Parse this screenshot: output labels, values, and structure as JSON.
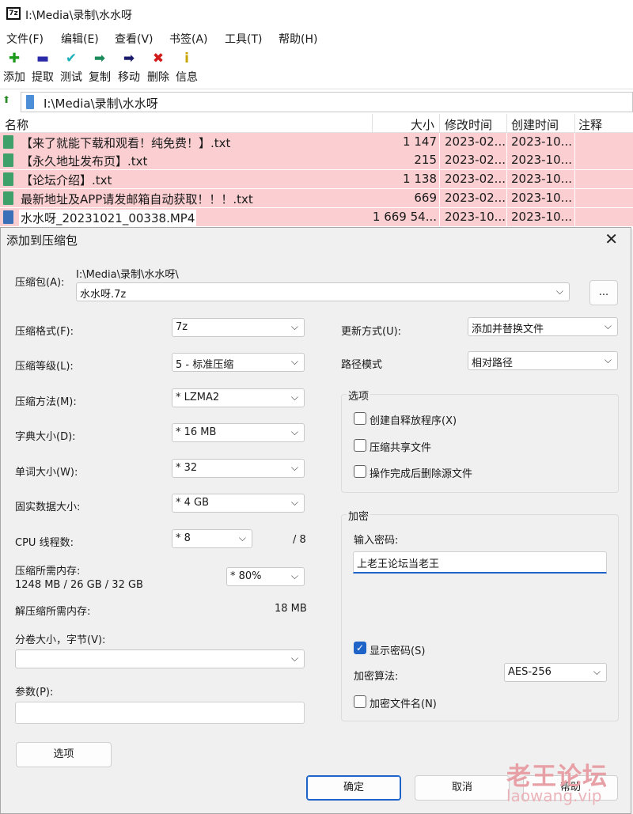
{
  "window": {
    "title": "I:\\Media\\录制\\水水呀",
    "app_icon": "7z"
  },
  "menu": [
    "文件(F)",
    "编辑(E)",
    "查看(V)",
    "书签(A)",
    "工具(T)",
    "帮助(H)"
  ],
  "toolbar": [
    {
      "label": "添加",
      "icon": "plus-icon",
      "glyph": "✚",
      "color": "#1b9a1b"
    },
    {
      "label": "提取",
      "icon": "minus-icon",
      "glyph": "▬",
      "color": "#2a2aa8"
    },
    {
      "label": "测试",
      "icon": "check-icon",
      "glyph": "✔",
      "color": "#1fb0b8"
    },
    {
      "label": "复制",
      "icon": "copy-arrow-icon",
      "glyph": "➡",
      "color": "#1a8a5a"
    },
    {
      "label": "移动",
      "icon": "move-arrow-icon",
      "glyph": "➡",
      "color": "#1a1a6a"
    },
    {
      "label": "删除",
      "icon": "delete-x-icon",
      "glyph": "✖",
      "color": "#d11a1a"
    },
    {
      "label": "信息",
      "icon": "info-icon",
      "glyph": "i",
      "color": "#c8a400"
    }
  ],
  "address": "I:\\Media\\录制\\水水呀",
  "columns": [
    "名称",
    "大小",
    "修改时间",
    "创建时间",
    "注释"
  ],
  "files": [
    {
      "name": "【来了就能下载和观看！纯免费！】.txt",
      "size": "1 147",
      "modified": "2023-02...",
      "created": "2023-10..."
    },
    {
      "name": "【永久地址发布页】.txt",
      "size": "215",
      "modified": "2023-02...",
      "created": "2023-10..."
    },
    {
      "name": "【论坛介绍】.txt",
      "size": "1 138",
      "modified": "2023-02...",
      "created": "2023-10..."
    },
    {
      "name": "最新地址及APP请发邮箱自动获取！！！.txt",
      "size": "669",
      "modified": "2023-02...",
      "created": "2023-10..."
    },
    {
      "name": "水水呀_20231021_00338.MP4",
      "size": "1 669 54...",
      "modified": "2023-10...",
      "created": "2023-10..."
    }
  ],
  "dialog": {
    "title": "添加到压缩包",
    "archive_label": "压缩包(A):",
    "archive_path": "I:\\Media\\录制\\水水呀\\",
    "archive_name": "水水呀.7z",
    "browse": "...",
    "format_label": "压缩格式(F):",
    "format": "7z",
    "level_label": "压缩等级(L):",
    "level": "5 - 标准压缩",
    "method_label": "压缩方法(M):",
    "method": "*  LZMA2",
    "dict_label": "字典大小(D):",
    "dict": "*  16 MB",
    "word_label": "单词大小(W):",
    "word": "*  32",
    "solid_label": "固实数据大小:",
    "solid": "*  4 GB",
    "cpu_label": "CPU 线程数:",
    "cpu": "*  8",
    "cpu_max": "/ 8",
    "mem_label": "压缩所需内存:",
    "mem_value": "1248 MB / 26 GB / 32 GB",
    "mem_pct": "* 80%",
    "decomp_label": "解压缩所需内存:",
    "decomp": "18 MB",
    "split_label": "分卷大小，字节(V):",
    "split": "",
    "params_label": "参数(P):",
    "params": "",
    "options_btn": "选项",
    "update_label": "更新方式(U):",
    "update": "添加并替换文件",
    "path_label": "路径模式",
    "path": "相对路径",
    "options_group": "选项",
    "sfx": "创建自释放程序(X)",
    "shared": "压缩共享文件",
    "delete_after": "操作完成后删除源文件",
    "enc_group": "加密",
    "pwd_label": "输入密码:",
    "password": "上老王论坛当老王",
    "show_pwd": "显示密码(S)",
    "enc_method_label": "加密算法:",
    "enc_method": "AES-256",
    "enc_names": "加密文件名(N)",
    "ok": "确定",
    "cancel": "取消",
    "help": "帮助"
  },
  "watermark": {
    "line1": "老王论坛",
    "line2": "laowang.vip"
  }
}
